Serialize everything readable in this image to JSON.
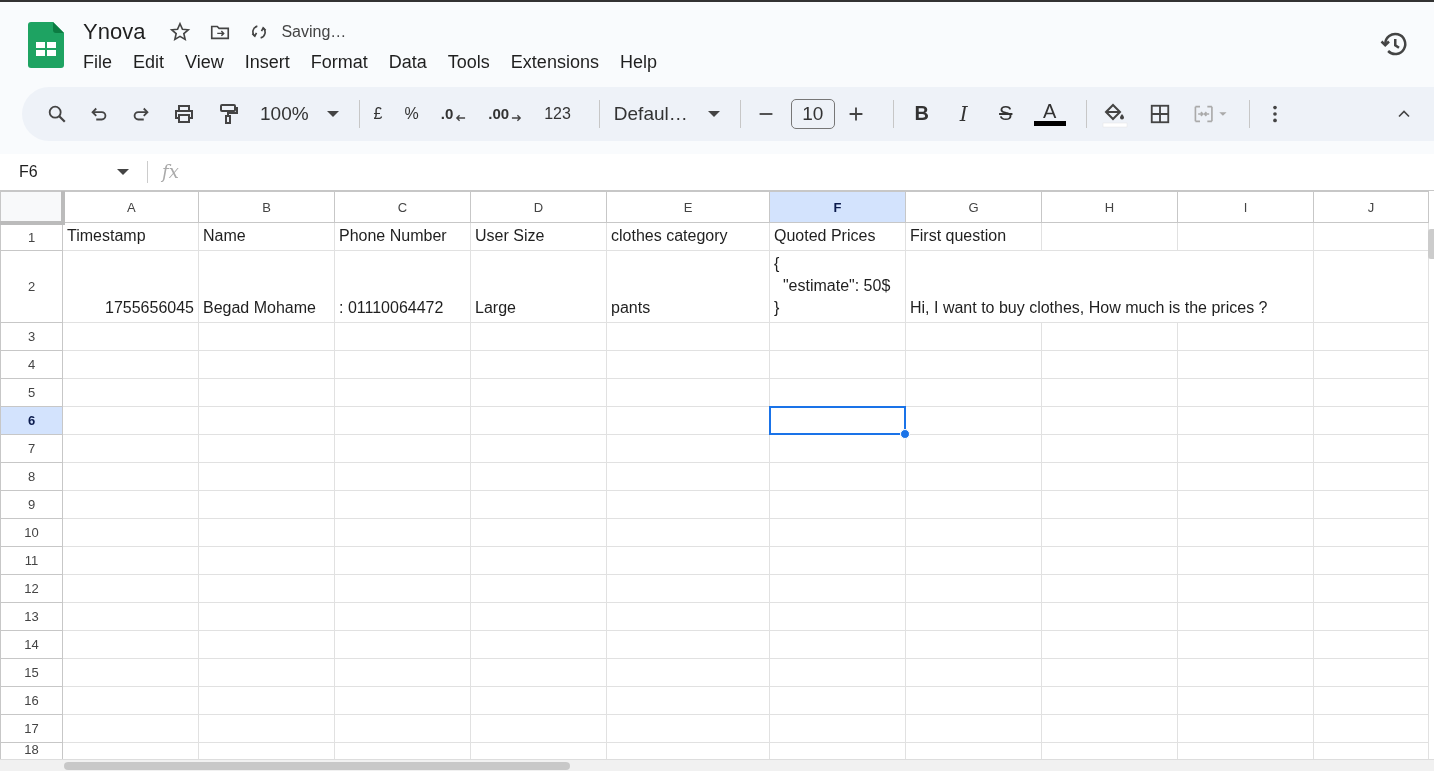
{
  "app": {
    "title": "Ynova",
    "status": "Saving…"
  },
  "menu": [
    "File",
    "Edit",
    "View",
    "Insert",
    "Format",
    "Data",
    "Tools",
    "Extensions",
    "Help"
  ],
  "toolbar": {
    "zoom": "100%",
    "currency": "£",
    "percent": "%",
    "decrease_decimal": ".0",
    "increase_decimal": ".00",
    "number_format": "123",
    "font": "Defaul…",
    "font_size": "10",
    "bold": "B",
    "italic": "I",
    "strikethrough": "S",
    "text_color": "A"
  },
  "name_box": "F6",
  "formula_label": "fx",
  "columns": [
    {
      "label": "A",
      "selected": false
    },
    {
      "label": "B",
      "selected": false
    },
    {
      "label": "C",
      "selected": false
    },
    {
      "label": "D",
      "selected": false
    },
    {
      "label": "E",
      "selected": false
    },
    {
      "label": "F",
      "selected": true
    },
    {
      "label": "G",
      "selected": false
    },
    {
      "label": "H",
      "selected": false
    },
    {
      "label": "I",
      "selected": false
    },
    {
      "label": "J",
      "selected": false
    }
  ],
  "rows": [
    {
      "number": "1",
      "selected": false,
      "cells": [
        {
          "text": "Timestamp",
          "kind": "text"
        },
        {
          "text": "Name",
          "kind": "text"
        },
        {
          "text": "Phone Number",
          "kind": "text"
        },
        {
          "text": "User Size",
          "kind": "text"
        },
        {
          "text": "clothes category",
          "kind": "text"
        },
        {
          "text": "Quoted Prices",
          "kind": "text"
        },
        {
          "text": "First question",
          "kind": "text"
        }
      ]
    },
    {
      "number": "2",
      "selected": false,
      "cells": [
        {
          "text": "1755656045",
          "kind": "number"
        },
        {
          "text": "Begad Mohame",
          "kind": "text"
        },
        {
          "text": ": 01110064472",
          "kind": "text"
        },
        {
          "text": "Large",
          "kind": "text"
        },
        {
          "text": "pants",
          "kind": "text"
        },
        {
          "text": "{\n  \"estimate\": 50$\n}",
          "kind": "text"
        },
        {
          "text": "Hi, I want to buy clothes, How much is the prices ?",
          "kind": "text"
        }
      ]
    },
    {
      "number": "3",
      "selected": false
    },
    {
      "number": "4",
      "selected": false
    },
    {
      "number": "5",
      "selected": false
    },
    {
      "number": "6",
      "selected": true
    },
    {
      "number": "7",
      "selected": false
    },
    {
      "number": "8",
      "selected": false
    },
    {
      "number": "9",
      "selected": false
    },
    {
      "number": "10",
      "selected": false
    },
    {
      "number": "11",
      "selected": false
    },
    {
      "number": "12",
      "selected": false
    },
    {
      "number": "13",
      "selected": false
    },
    {
      "number": "14",
      "selected": false
    },
    {
      "number": "15",
      "selected": false
    },
    {
      "number": "16",
      "selected": false
    },
    {
      "number": "17",
      "selected": false
    },
    {
      "number": "18",
      "selected": false
    }
  ]
}
